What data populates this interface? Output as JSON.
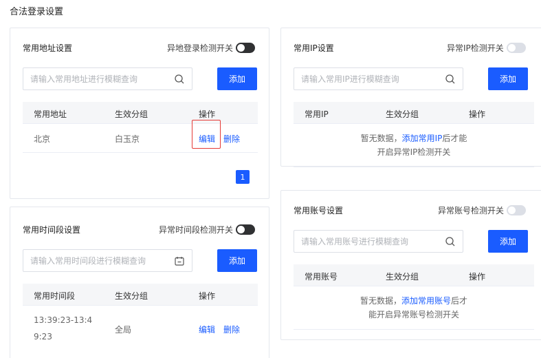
{
  "page_title": "合法登录设置",
  "address_card": {
    "title": "常用地址设置",
    "switch_label": "异地登录检测开关",
    "search_placeholder": "请输入常用地址进行模糊查询",
    "add_label": "添加",
    "columns": [
      "常用地址",
      "生效分组",
      "操作"
    ],
    "rows": [
      {
        "address": "北京",
        "group": "白玉京",
        "edit": "编辑",
        "delete": "删除"
      }
    ],
    "page": "1"
  },
  "ip_card": {
    "title": "常用IP设置",
    "switch_label": "异常IP检测开关",
    "search_placeholder": "请输入常用IP进行模糊查询",
    "add_label": "添加",
    "columns": [
      "常用IP",
      "生效分组",
      "操作"
    ],
    "empty_prefix": "暂无数据，",
    "empty_link": "添加常用IP",
    "empty_suffix": "后才能",
    "empty_line2": "开启异常IP检测开关"
  },
  "time_card": {
    "title": "常用时间段设置",
    "switch_label": "异常时间段检测开关",
    "search_placeholder": "请输入常用时间段进行模糊查询",
    "add_label": "添加",
    "columns": [
      "常用时间段",
      "生效分组",
      "操作"
    ],
    "rows": [
      {
        "time_line1": "13:39:23-13:4",
        "time_line2": "9:23",
        "group": "全局",
        "edit": "编辑",
        "delete": "删除"
      }
    ]
  },
  "account_card": {
    "title": "常用账号设置",
    "switch_label": "异常账号检测开关",
    "search_placeholder": "请输入常用账号进行模糊查询",
    "add_label": "添加",
    "columns": [
      "常用账号",
      "生效分组",
      "操作"
    ],
    "empty_prefix": "暂无数据，",
    "empty_link": "添加常用账号",
    "empty_suffix": "后才",
    "empty_line2": "能开启异常账号检测开关"
  },
  "colors": {
    "primary": "#1a5cff",
    "highlight_border": "#e53935",
    "toggle_on": "#303133",
    "toggle_off": "#dcdfe6"
  },
  "icons": {
    "search": "search-icon",
    "calendar": "calendar-icon"
  }
}
